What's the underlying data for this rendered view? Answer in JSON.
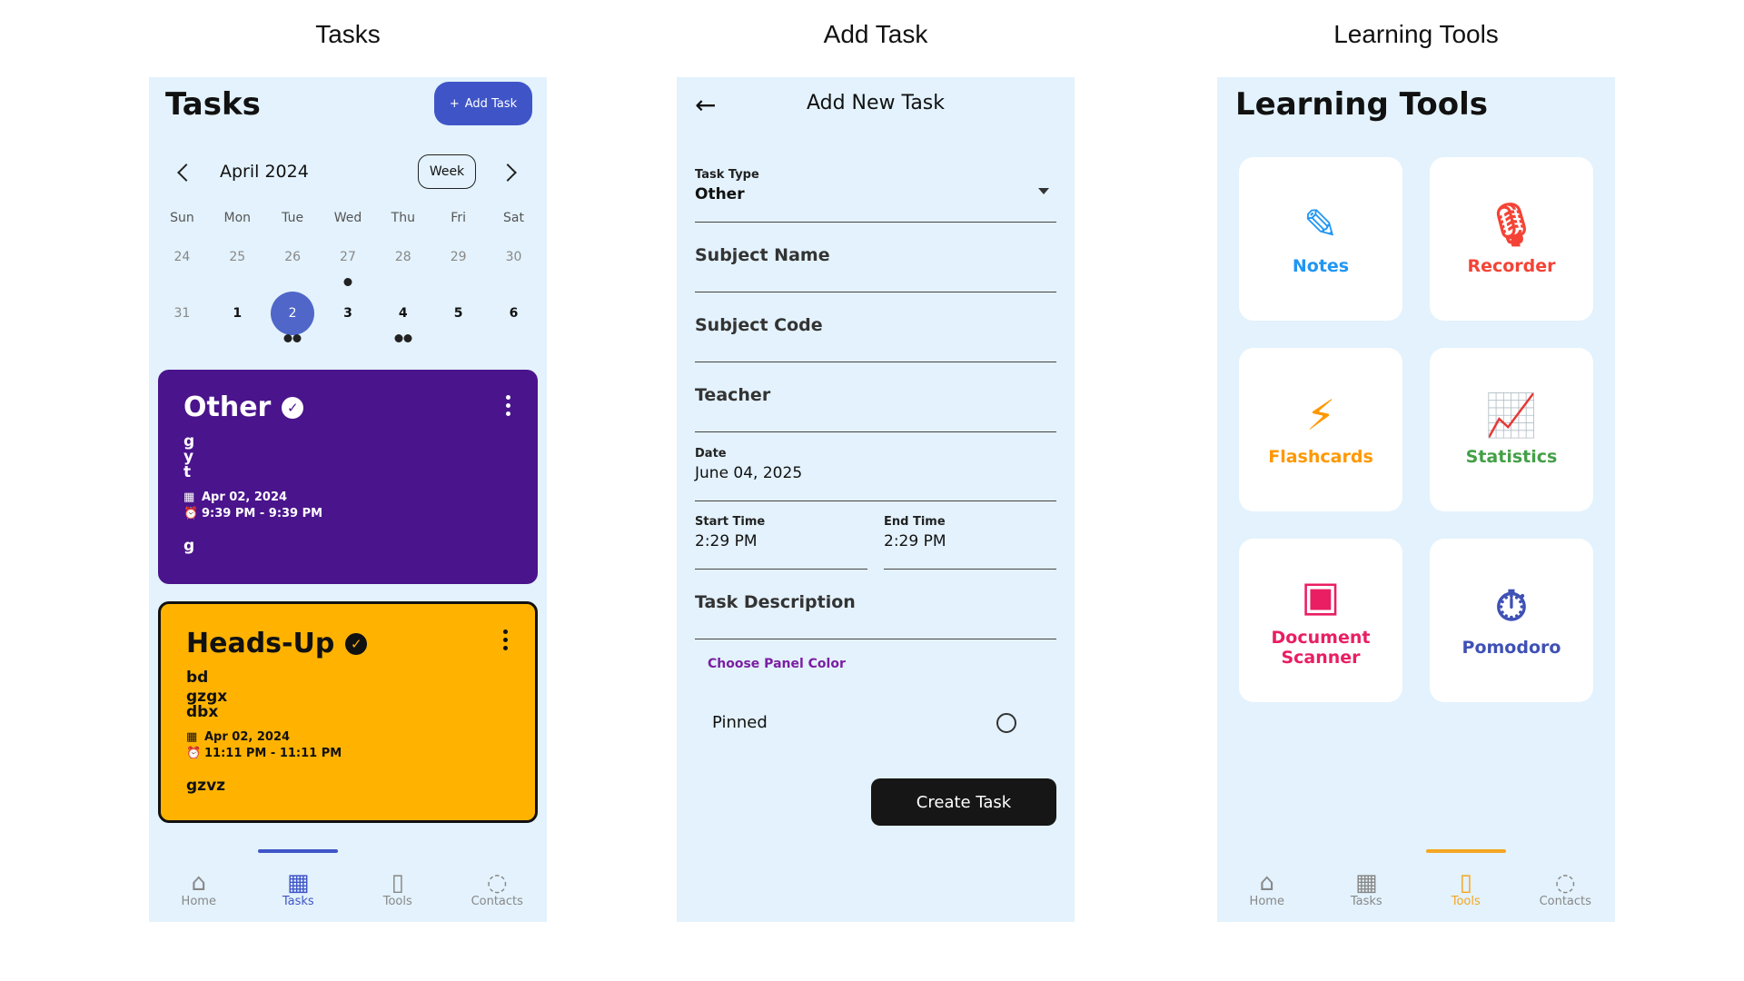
{
  "captions": {
    "tasks": "Tasks",
    "add": "Add Task",
    "tools": "Learning Tools"
  },
  "tasks_screen": {
    "title": "Tasks",
    "add_button": "Add Task",
    "month": "April 2024",
    "view_toggle": "Week",
    "weekdays": [
      "Sun",
      "Mon",
      "Tue",
      "Wed",
      "Thu",
      "Fri",
      "Sat"
    ],
    "week1": [
      "24",
      "25",
      "26",
      "27",
      "28",
      "29",
      "30"
    ],
    "week2": [
      "31",
      "1",
      "2",
      "3",
      "4",
      "5",
      "6"
    ],
    "cards": [
      {
        "title": "Other",
        "lines": [
          "g",
          "y",
          "t"
        ],
        "date": "Apr 02, 2024",
        "time": "9:39 PM - 9:39 PM",
        "footer": "g",
        "color": "#4a148c"
      },
      {
        "title": "Heads-Up",
        "lines": [
          "bd",
          "gzgx",
          "dbx"
        ],
        "date": "Apr 02, 2024",
        "time": "11:11 PM - 11:11 PM",
        "footer": "gzvz",
        "color": "#ffb300"
      }
    ]
  },
  "nav": {
    "home": "Home",
    "tasks": "Tasks",
    "tools": "Tools",
    "contacts": "Contacts"
  },
  "add_screen": {
    "title": "Add New Task",
    "task_type_label": "Task Type",
    "task_type_value": "Other",
    "subject_name": "Subject Name",
    "subject_code": "Subject Code",
    "teacher": "Teacher",
    "date_label": "Date",
    "date_value": "June 04, 2025",
    "start_label": "Start Time",
    "start_value": "2:29 PM",
    "end_label": "End Time",
    "end_value": "2:29 PM",
    "description": "Task Description",
    "panel_color": "Choose Panel Color",
    "pinned": "Pinned",
    "create_button": "Create Task"
  },
  "tools_screen": {
    "title": "Learning Tools",
    "tools": [
      {
        "label": "Notes",
        "icon": "pencil-icon",
        "color": "#2196f3"
      },
      {
        "label": "Recorder",
        "icon": "microphone-icon",
        "color": "#f44336"
      },
      {
        "label": "Flashcards",
        "icon": "lightning-icon",
        "color": "#ff9800"
      },
      {
        "label": "Statistics",
        "icon": "chart-icon",
        "color": "#43a047"
      },
      {
        "label": "Document Scanner",
        "icon": "scanner-icon",
        "color": "#e91e63"
      },
      {
        "label": "Pomodoro",
        "icon": "timer-icon",
        "color": "#3f51b5"
      }
    ]
  }
}
